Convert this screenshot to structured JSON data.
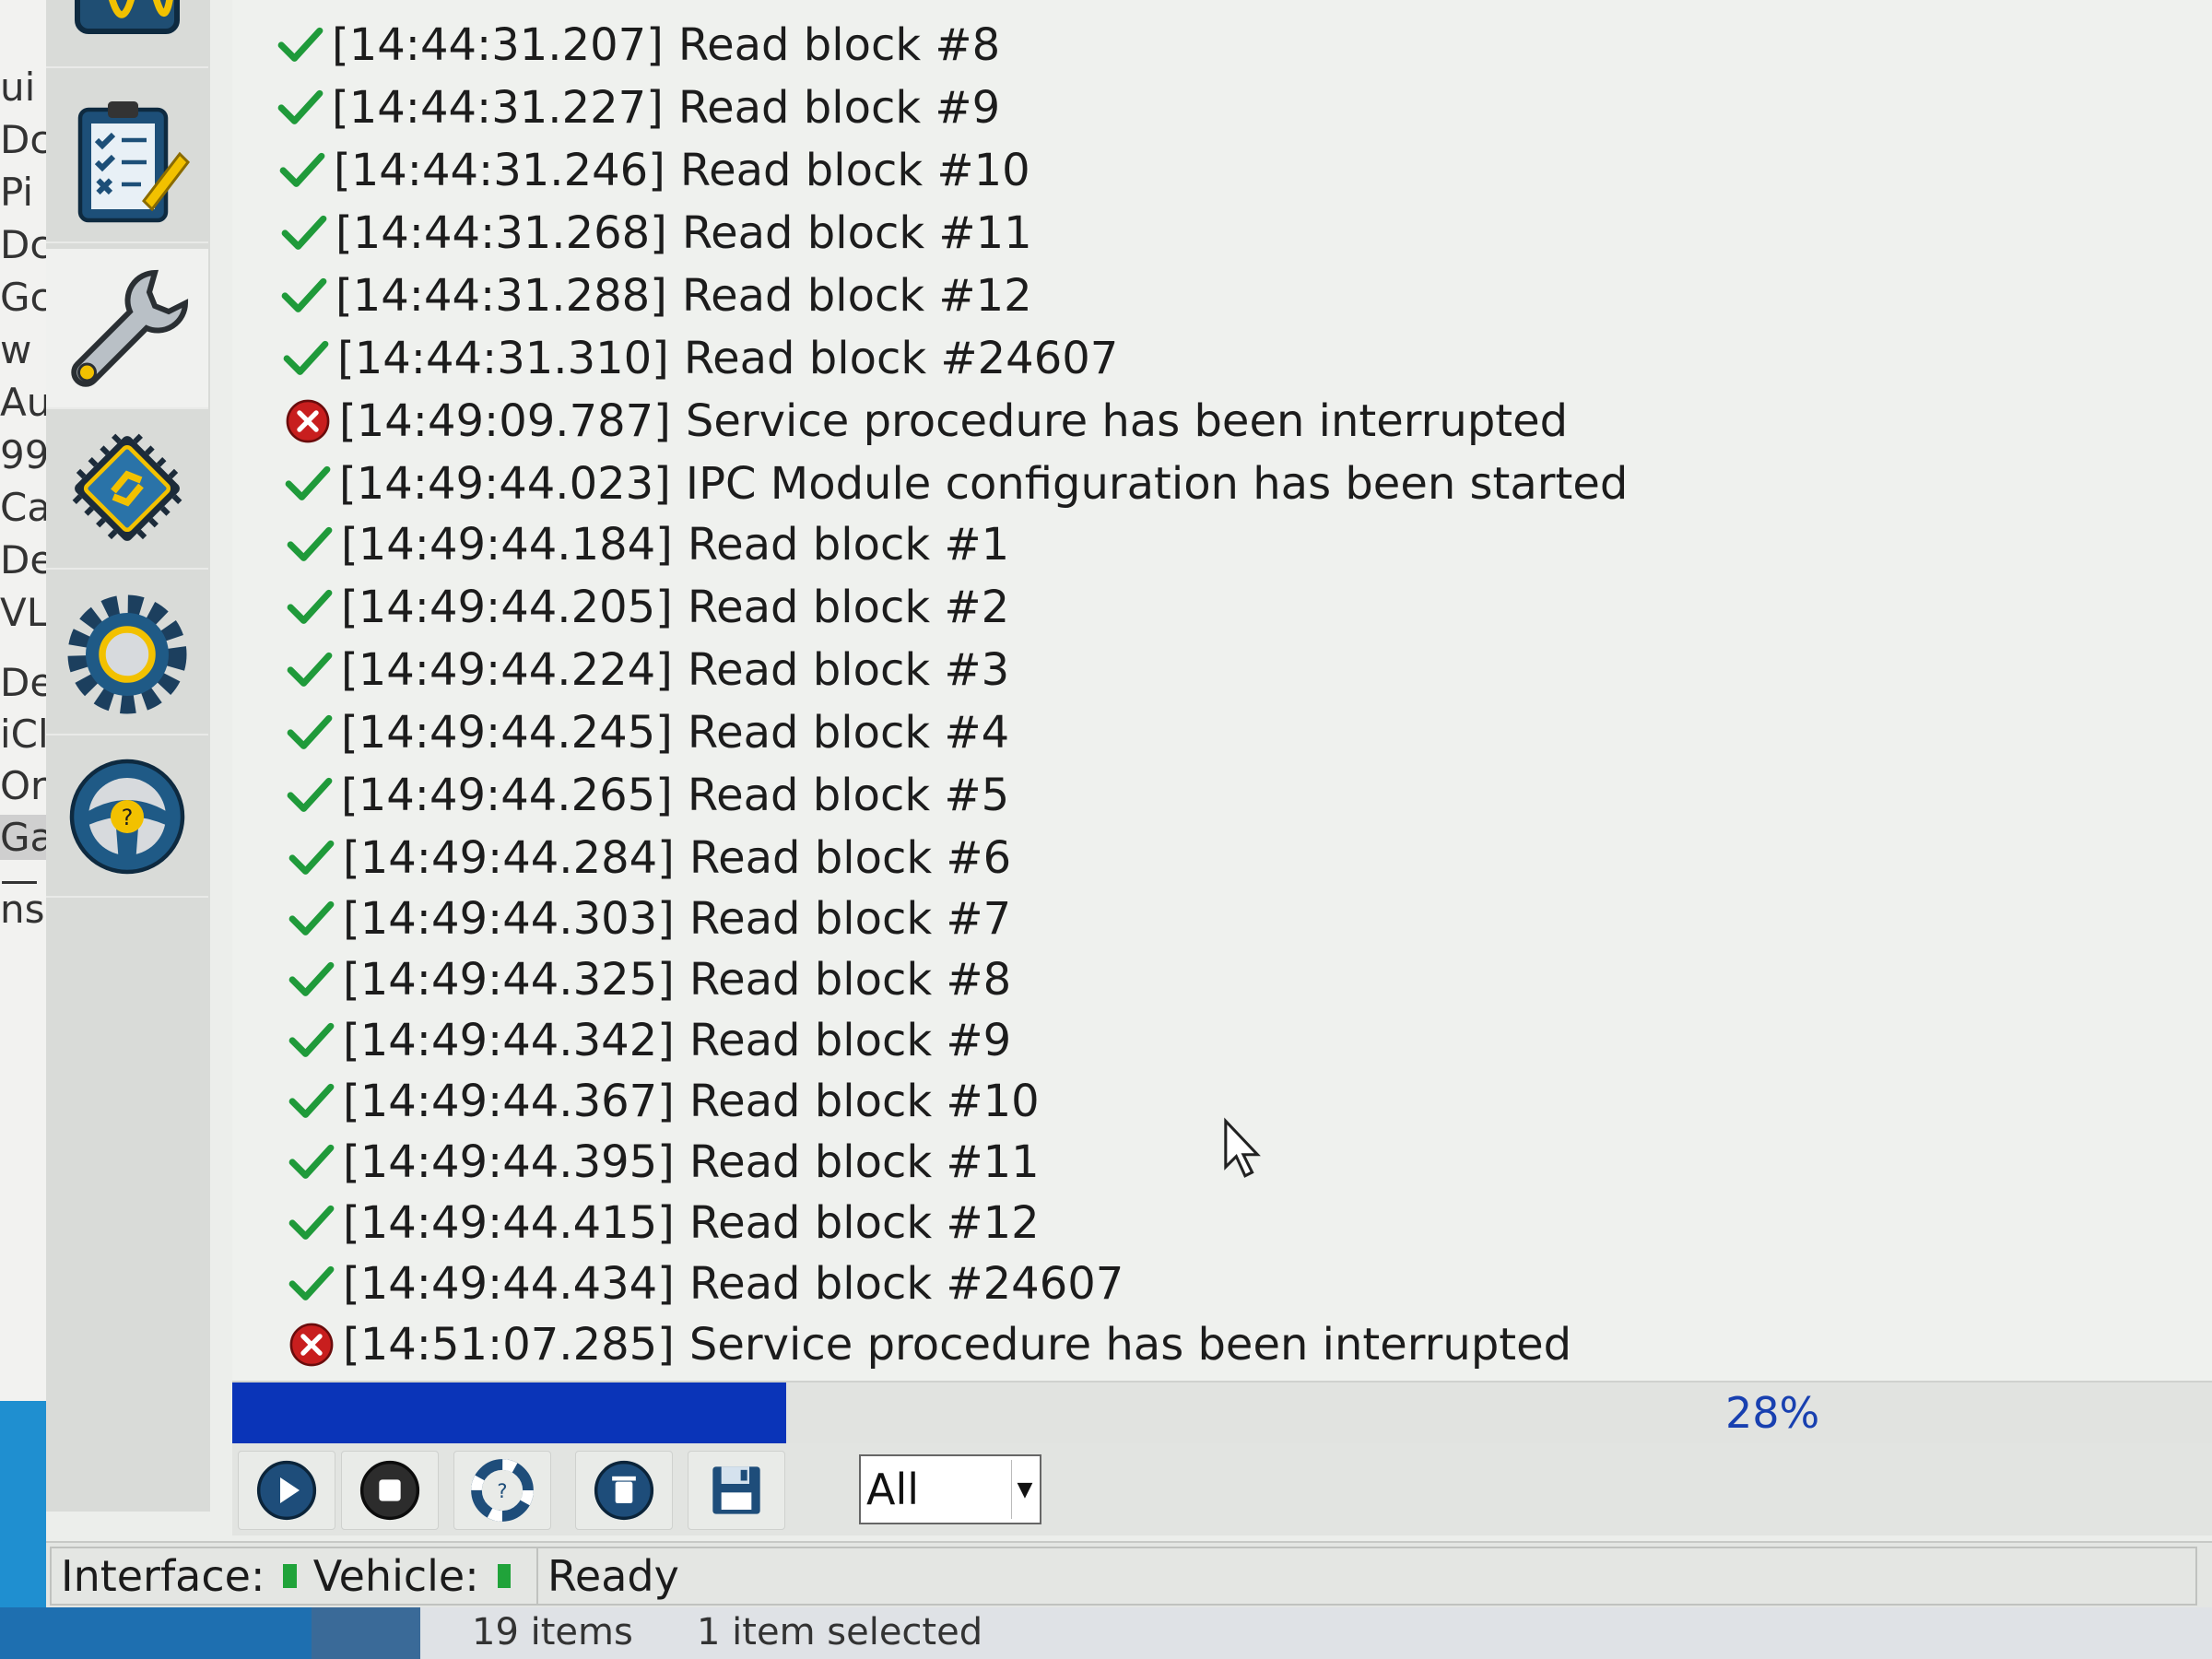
{
  "background_window": {
    "fragments": [
      "ui",
      "Dc",
      "Pi",
      "Dc",
      "Gc",
      "w",
      "Au",
      "99",
      "Ca",
      "De",
      "VL",
      "Des",
      "iCl",
      "Or",
      "Ga",
      "—",
      "ns"
    ]
  },
  "sidebar": {
    "tools": [
      {
        "name": "oscilloscope-icon"
      },
      {
        "name": "clipboard-checklist-icon"
      },
      {
        "name": "wrench-icon"
      },
      {
        "name": "chip-module-icon"
      },
      {
        "name": "gear-icon"
      },
      {
        "name": "steering-wheel-help-icon"
      }
    ]
  },
  "log": {
    "entries": [
      {
        "status": "ok",
        "time": "[14:44:31.207]",
        "message": "Read block #8"
      },
      {
        "status": "ok",
        "time": "[14:44:31.227]",
        "message": "Read block #9"
      },
      {
        "status": "ok",
        "time": "[14:44:31.246]",
        "message": "Read block #10"
      },
      {
        "status": "ok",
        "time": "[14:44:31.268]",
        "message": "Read block #11"
      },
      {
        "status": "ok",
        "time": "[14:44:31.288]",
        "message": "Read block #12"
      },
      {
        "status": "ok",
        "time": "[14:44:31.310]",
        "message": "Read block #24607"
      },
      {
        "status": "error",
        "time": "[14:49:09.787]",
        "message": "Service procedure has been interrupted"
      },
      {
        "status": "ok",
        "time": "[14:49:44.023]",
        "message": "IPC Module configuration has been started"
      },
      {
        "status": "ok",
        "time": "[14:49:44.184]",
        "message": "Read block #1"
      },
      {
        "status": "ok",
        "time": "[14:49:44.205]",
        "message": "Read block #2"
      },
      {
        "status": "ok",
        "time": "[14:49:44.224]",
        "message": "Read block #3"
      },
      {
        "status": "ok",
        "time": "[14:49:44.245]",
        "message": "Read block #4"
      },
      {
        "status": "ok",
        "time": "[14:49:44.265]",
        "message": "Read block #5"
      },
      {
        "status": "ok",
        "time": "[14:49:44.284]",
        "message": "Read block #6"
      },
      {
        "status": "ok",
        "time": "[14:49:44.303]",
        "message": "Read block #7"
      },
      {
        "status": "ok",
        "time": "[14:49:44.325]",
        "message": "Read block #8"
      },
      {
        "status": "ok",
        "time": "[14:49:44.342]",
        "message": "Read block #9"
      },
      {
        "status": "ok",
        "time": "[14:49:44.367]",
        "message": "Read block #10"
      },
      {
        "status": "ok",
        "time": "[14:49:44.395]",
        "message": "Read block #11"
      },
      {
        "status": "ok",
        "time": "[14:49:44.415]",
        "message": "Read block #12"
      },
      {
        "status": "ok",
        "time": "[14:49:44.434]",
        "message": "Read block #24607"
      },
      {
        "status": "error",
        "time": "[14:51:07.285]",
        "message": "Service procedure has been interrupted"
      }
    ]
  },
  "progress": {
    "percent": 28,
    "label": "28%"
  },
  "toolbar": {
    "buttons": [
      {
        "name": "play-button",
        "icon": "play-icon"
      },
      {
        "name": "stop-button",
        "icon": "stop-icon"
      },
      {
        "name": "help-lifebuoy-button",
        "icon": "lifebuoy-icon"
      },
      {
        "name": "clear-log-button",
        "icon": "trash-icon"
      },
      {
        "name": "save-log-button",
        "icon": "floppy-disk-icon"
      }
    ],
    "filter": {
      "value": "All"
    }
  },
  "status_bar": {
    "interface_label": "Interface:",
    "vehicle_label": "Vehicle:",
    "state": "Ready"
  },
  "explorer_status": {
    "items_count": "19 items",
    "selected": "1 item selected"
  },
  "colors": {
    "ok_check": "#1f9a3a",
    "error": "#c81e1e",
    "progress_fill": "#0a34b8",
    "progress_text": "#1840b0",
    "led_green": "#20a33a"
  }
}
